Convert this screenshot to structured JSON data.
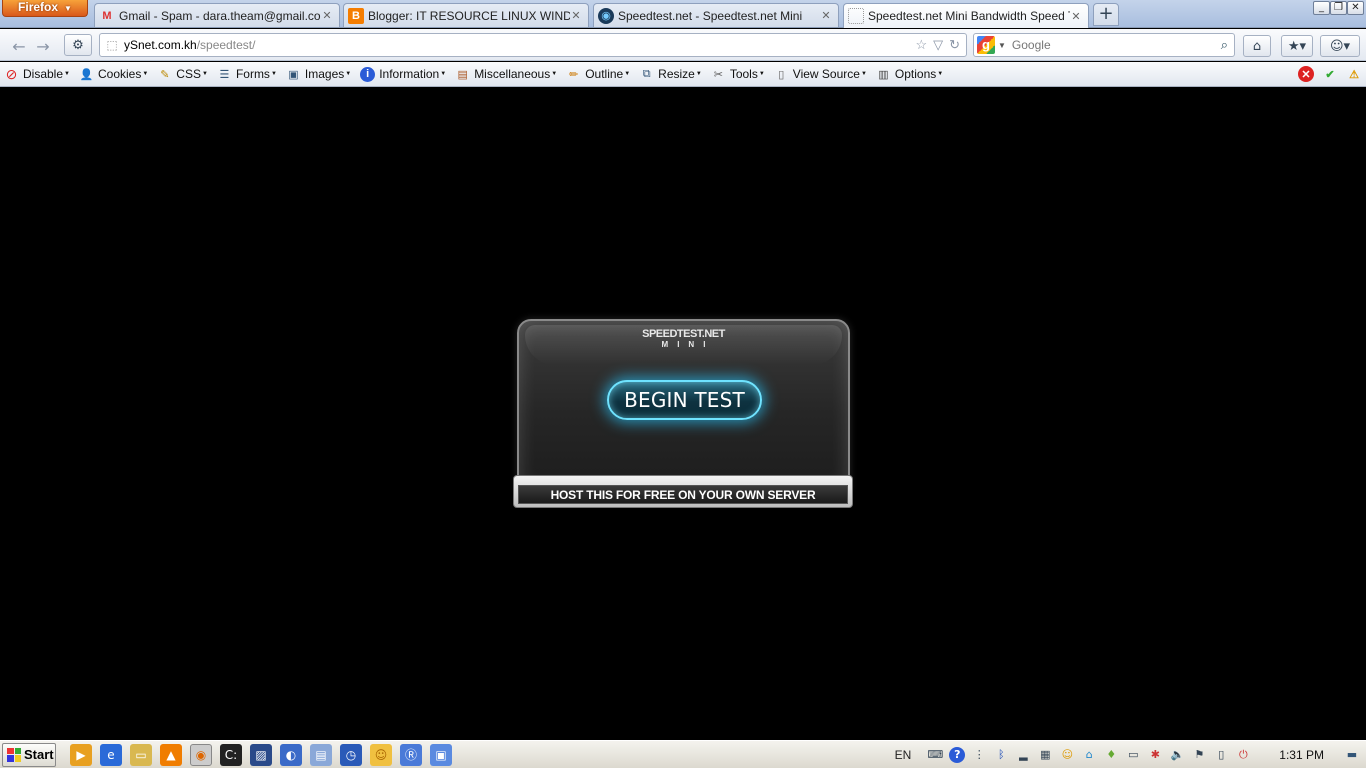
{
  "browser": {
    "menu_button": "Firefox",
    "tabs": [
      {
        "title": "Gmail - Spam - dara.theam@gmail.com",
        "icon": "gmail-icon",
        "active": false
      },
      {
        "title": "Blogger: IT RESOURCE LINUX WINDOWS...",
        "icon": "blogger-icon",
        "active": false
      },
      {
        "title": "Speedtest.net - Speedtest.net Mini",
        "icon": "speedtest-icon",
        "active": false
      },
      {
        "title": "Speedtest.net Mini Bandwidth Speed Test",
        "icon": "blank-page-icon",
        "active": true
      }
    ],
    "new_tab": "+",
    "url_host": "ySnet.com.kh",
    "url_path": "/speedtest/",
    "search_placeholder": "Google"
  },
  "dev_toolbar": {
    "items": [
      {
        "label": "Disable",
        "icon": "disable-icon"
      },
      {
        "label": "Cookies",
        "icon": "cookies-icon"
      },
      {
        "label": "CSS",
        "icon": "css-icon"
      },
      {
        "label": "Forms",
        "icon": "forms-icon"
      },
      {
        "label": "Images",
        "icon": "images-icon"
      },
      {
        "label": "Information",
        "icon": "information-icon"
      },
      {
        "label": "Miscellaneous",
        "icon": "miscellaneous-icon"
      },
      {
        "label": "Outline",
        "icon": "outline-icon"
      },
      {
        "label": "Resize",
        "icon": "resize-icon"
      },
      {
        "label": "Tools",
        "icon": "tools-icon"
      },
      {
        "label": "View Source",
        "icon": "view-source-icon"
      },
      {
        "label": "Options",
        "icon": "options-icon"
      }
    ]
  },
  "speedtest": {
    "logo_main": "SPEEDTEST.NET",
    "logo_sub": "MINI",
    "begin_label": "BEGIN TEST",
    "host_label": "HOST THIS FOR FREE ON YOUR OWN SERVER",
    "accent": "#6fe3ff"
  },
  "taskbar": {
    "start_label": "Start",
    "language": "EN",
    "clock": "1:31 PM"
  }
}
